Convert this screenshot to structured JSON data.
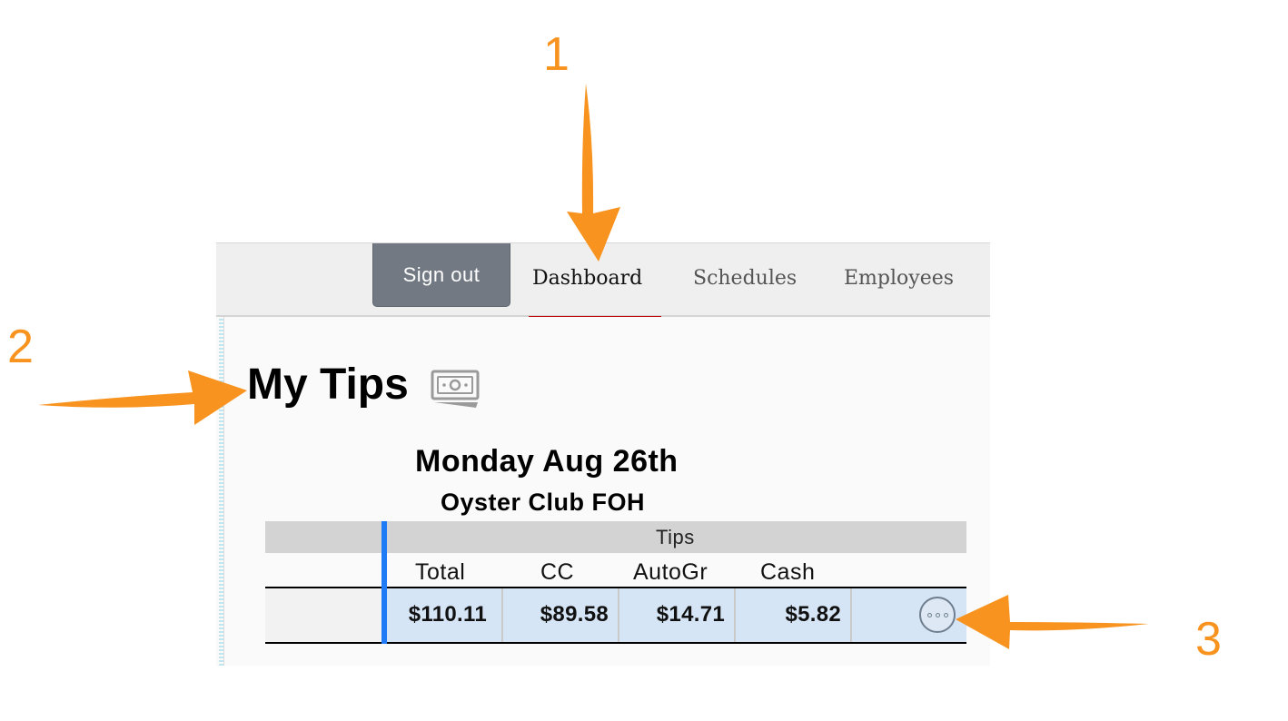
{
  "annotations": {
    "label_1": "1",
    "label_2": "2",
    "label_3": "3",
    "color": "#f7931e"
  },
  "nav": {
    "sign_out": "Sign out",
    "tabs": [
      {
        "label": "Dashboard",
        "active": true
      },
      {
        "label": "Schedules"
      },
      {
        "label": "Employees"
      }
    ],
    "active_color": "#c00000",
    "marker": "*"
  },
  "page": {
    "title": "My Tips",
    "title_icon": "money-icon"
  },
  "tips": {
    "date": "Monday Aug 26th",
    "location": "Oyster Club FOH",
    "group_header": "Tips",
    "columns": [
      "Total",
      "CC",
      "AutoGr",
      "Cash"
    ],
    "row": {
      "total": "$110.11",
      "cc": "$89.58",
      "autogr": "$14.71",
      "cash": "$5.82"
    },
    "row_action_icon": "more-options-icon"
  }
}
